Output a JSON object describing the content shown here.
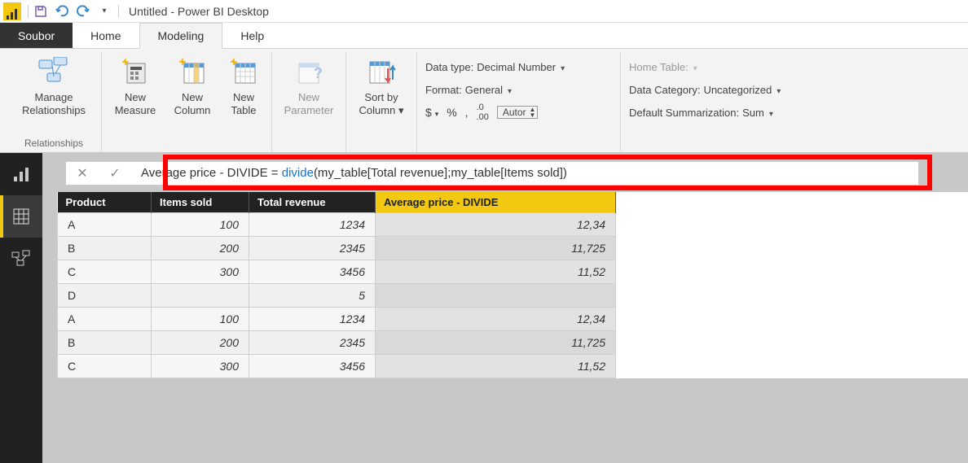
{
  "titlebar": {
    "app_title": "Untitled - Power BI Desktop"
  },
  "tabs": {
    "file": "Soubor",
    "items": [
      "Home",
      "Modeling",
      "Help"
    ],
    "active_index": 1
  },
  "ribbon": {
    "relationships": {
      "manage": "Manage\nRelationships",
      "group": "Relationships"
    },
    "calculations": {
      "new_measure": "New\nMeasure",
      "new_column": "New\nColumn",
      "new_table": "New\nTable"
    },
    "whatif": {
      "new_parameter": "New\nParameter"
    },
    "sort": {
      "sort_by": "Sort by\nColumn ▾"
    },
    "formatting": {
      "data_type_label": "Data type:",
      "data_type_value": "Decimal Number",
      "format_label": "Format:",
      "format_value": "General",
      "currency": "$",
      "percent": "%",
      "thousand": ",",
      "decimals_icon": ".0₀",
      "precision": "Autor"
    },
    "properties": {
      "home_table_label": "Home Table:",
      "data_category_label": "Data Category:",
      "data_category_value": "Uncategorized",
      "summarization_label": "Default Summarization:",
      "summarization_value": "Sum"
    }
  },
  "formula": {
    "measure_name": "Average price - DIVIDE",
    "equals": " = ",
    "func": "divide",
    "args": "(my_table[Total revenue];my_table[Items sold])"
  },
  "table": {
    "columns": [
      "Product",
      "Items sold",
      "Total revenue",
      "Average price - DIVIDE"
    ],
    "selected_col": 3,
    "rows": [
      {
        "product": "A",
        "items": "100",
        "revenue": "1234",
        "avg": "12,34"
      },
      {
        "product": "B",
        "items": "200",
        "revenue": "2345",
        "avg": "11,725"
      },
      {
        "product": "C",
        "items": "300",
        "revenue": "3456",
        "avg": "11,52"
      },
      {
        "product": "D",
        "items": "",
        "revenue": "5",
        "avg": ""
      },
      {
        "product": "A",
        "items": "100",
        "revenue": "1234",
        "avg": "12,34"
      },
      {
        "product": "B",
        "items": "200",
        "revenue": "2345",
        "avg": "11,725"
      },
      {
        "product": "C",
        "items": "300",
        "revenue": "3456",
        "avg": "11,52"
      }
    ]
  }
}
